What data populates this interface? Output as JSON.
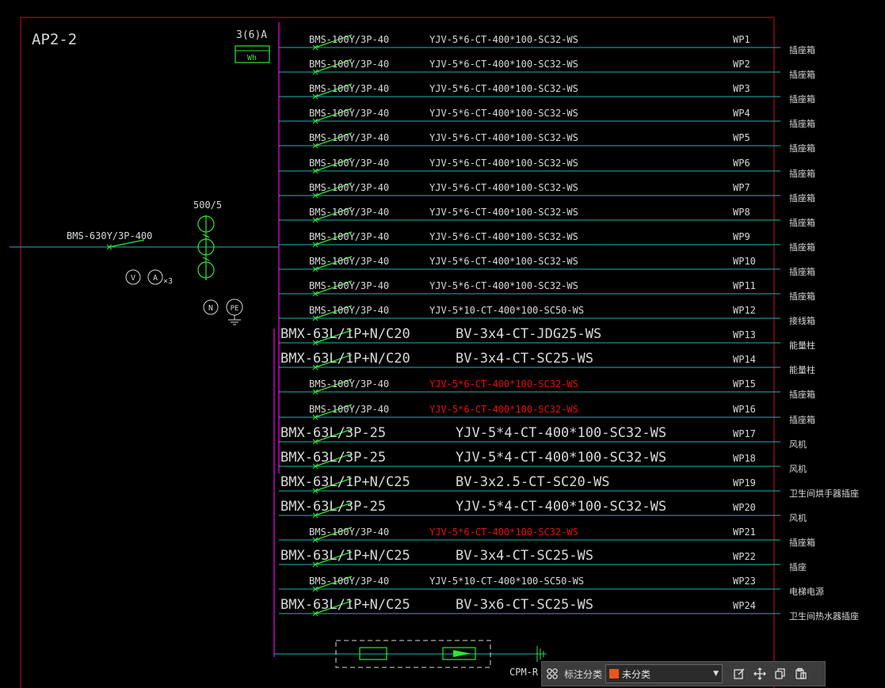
{
  "colors": {
    "frame": "#c8102e",
    "bus": "#c800c8",
    "wire": "#1fb5b5",
    "switch": "#2ee82e",
    "text": "#d8d8d8",
    "highlight": "#e01010",
    "swatch": "#e8561b"
  },
  "panel": {
    "name": "AP2-2",
    "main_breaker": "BMS-630Y/3P-400",
    "ct_ratio": "500/5",
    "meter_rating": "3(6)A",
    "meter_label": "Wh",
    "voltmeter": "V",
    "ammeter": "A",
    "ammeter_count": "×3",
    "neutral": "N",
    "earth": "PE",
    "spd_label": "CPM-R"
  },
  "circuits": [
    {
      "breaker": "BMS-100Y/3P-40",
      "cable": "YJV-5*6-CT-400*100-SC32-WS",
      "id": "WP1",
      "load": "插座箱",
      "big": false,
      "hl": false
    },
    {
      "breaker": "BMS-100Y/3P-40",
      "cable": "YJV-5*6-CT-400*100-SC32-WS",
      "id": "WP2",
      "load": "插座箱",
      "big": false,
      "hl": false
    },
    {
      "breaker": "BMS-100Y/3P-40",
      "cable": "YJV-5*6-CT-400*100-SC32-WS",
      "id": "WP3",
      "load": "插座箱",
      "big": false,
      "hl": false
    },
    {
      "breaker": "BMS-100Y/3P-40",
      "cable": "YJV-5*6-CT-400*100-SC32-WS",
      "id": "WP4",
      "load": "插座箱",
      "big": false,
      "hl": false
    },
    {
      "breaker": "BMS-100Y/3P-40",
      "cable": "YJV-5*6-CT-400*100-SC32-WS",
      "id": "WP5",
      "load": "插座箱",
      "big": false,
      "hl": false
    },
    {
      "breaker": "BMS-100Y/3P-40",
      "cable": "YJV-5*6-CT-400*100-SC32-WS",
      "id": "WP6",
      "load": "插座箱",
      "big": false,
      "hl": false
    },
    {
      "breaker": "BMS-100Y/3P-40",
      "cable": "YJV-5*6-CT-400*100-SC32-WS",
      "id": "WP7",
      "load": "插座箱",
      "big": false,
      "hl": false
    },
    {
      "breaker": "BMS-100Y/3P-40",
      "cable": "YJV-5*6-CT-400*100-SC32-WS",
      "id": "WP8",
      "load": "插座箱",
      "big": false,
      "hl": false
    },
    {
      "breaker": "BMS-100Y/3P-40",
      "cable": "YJV-5*6-CT-400*100-SC32-WS",
      "id": "WP9",
      "load": "插座箱",
      "big": false,
      "hl": false
    },
    {
      "breaker": "BMS-100Y/3P-40",
      "cable": "YJV-5*6-CT-400*100-SC32-WS",
      "id": "WP10",
      "load": "插座箱",
      "big": false,
      "hl": false
    },
    {
      "breaker": "BMS-100Y/3P-40",
      "cable": "YJV-5*6-CT-400*100-SC32-WS",
      "id": "WP11",
      "load": "插座箱",
      "big": false,
      "hl": false
    },
    {
      "breaker": "BMS-100Y/3P-40",
      "cable": "YJV-5*10-CT-400*100-SC50-WS",
      "id": "WP12",
      "load": "接线箱",
      "big": false,
      "hl": false
    },
    {
      "breaker": "BMX-63L/1P+N/C20",
      "cable": "BV-3x4-CT-JDG25-WS",
      "id": "WP13",
      "load": "能量柱",
      "big": true,
      "hl": false
    },
    {
      "breaker": "BMX-63L/1P+N/C20",
      "cable": "BV-3x4-CT-SC25-WS",
      "id": "WP14",
      "load": "能量柱",
      "big": true,
      "hl": false
    },
    {
      "breaker": "BMS-100Y/3P-40",
      "cable": "YJV-5*6-CT-400*100-SC32-WS",
      "id": "WP15",
      "load": "插座箱",
      "big": false,
      "hl": true
    },
    {
      "breaker": "BMS-100Y/3P-40",
      "cable": "YJV-5*6-CT-400*100-SC32-WS",
      "id": "WP16",
      "load": "插座箱",
      "big": false,
      "hl": true
    },
    {
      "breaker": "BMX-63L/3P-25",
      "cable": "YJV-5*4-CT-400*100-SC32-WS",
      "id": "WP17",
      "load": "风机",
      "big": true,
      "hl": false
    },
    {
      "breaker": "BMX-63L/3P-25",
      "cable": "YJV-5*4-CT-400*100-SC32-WS",
      "id": "WP18",
      "load": "风机",
      "big": true,
      "hl": false
    },
    {
      "breaker": "BMX-63L/1P+N/C25",
      "cable": "BV-3x2.5-CT-SC20-WS",
      "id": "WP19",
      "load": "卫生间烘手器插座",
      "big": true,
      "hl": false
    },
    {
      "breaker": "BMX-63L/3P-25",
      "cable": "YJV-5*4-CT-400*100-SC32-WS",
      "id": "WP20",
      "load": "风机",
      "big": true,
      "hl": false
    },
    {
      "breaker": "BMS-100Y/3P-40",
      "cable": "YJV-5*6-CT-400*100-SC32-WS",
      "id": "WP21",
      "load": "插座箱",
      "big": false,
      "hl": true
    },
    {
      "breaker": "BMX-63L/1P+N/C25",
      "cable": "BV-3x4-CT-SC25-WS",
      "id": "WP22",
      "load": "插座",
      "big": true,
      "hl": false
    },
    {
      "breaker": "BMS-100Y/3P-40",
      "cable": "YJV-5*10-CT-400*100-SC50-WS",
      "id": "WP23",
      "load": "电梯电源",
      "big": false,
      "hl": false
    },
    {
      "breaker": "BMX-63L/1P+N/C25",
      "cable": "BV-3x6-CT-SC25-WS",
      "id": "WP24",
      "load": "卫生间热水器插座",
      "big": true,
      "hl": false
    }
  ],
  "toolbar": {
    "grid_icon": "grid-icon",
    "label": "标注分类",
    "category_value": "未分类",
    "edit_icon": "edit-icon",
    "move_icon": "move-icon",
    "copy_icon": "copy-icon",
    "paste_icon": "paste-icon"
  }
}
